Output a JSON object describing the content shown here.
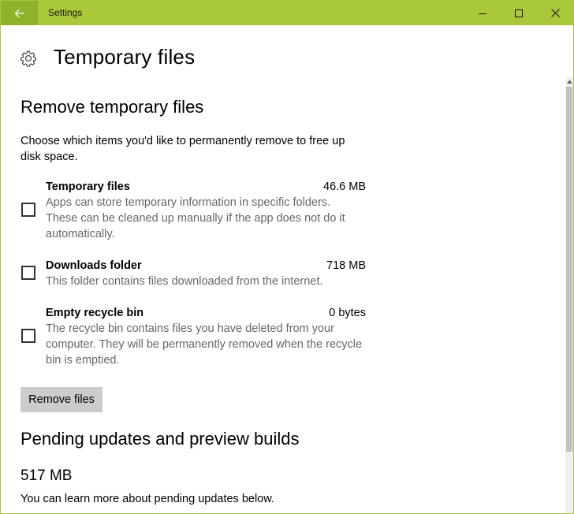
{
  "window": {
    "title": "Settings",
    "back_icon": "arrow-left-icon",
    "controls": [
      "minimize-icon",
      "maximize-icon",
      "close-icon"
    ],
    "accent_color": "#a9c93b"
  },
  "header": {
    "icon": "gear-icon",
    "title": "Temporary files"
  },
  "remove_section": {
    "title": "Remove temporary files",
    "description": "Choose which items you'd like to permanently remove to free up disk space.",
    "items": [
      {
        "name": "Temporary files",
        "size": "46.6 MB",
        "description": "Apps can store temporary information in specific folders. These can be cleaned up manually if the app does not do it automatically.",
        "checked": false
      },
      {
        "name": "Downloads folder",
        "size": "718 MB",
        "description": "This folder contains files downloaded from the internet.",
        "checked": false
      },
      {
        "name": "Empty recycle bin",
        "size": "0 bytes",
        "description": "The recycle bin contains files you have deleted from your computer. They will be permanently removed when the recycle bin is emptied.",
        "checked": false
      }
    ],
    "button_label": "Remove files"
  },
  "pending_section": {
    "title": "Pending updates and preview builds",
    "size": "517 MB",
    "text": "You can learn more about pending updates below."
  }
}
